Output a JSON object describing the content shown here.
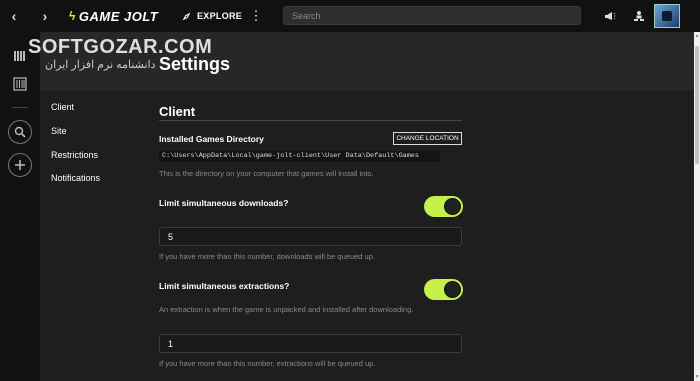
{
  "topbar": {
    "back_icon": "chevron-left-icon",
    "forward_icon": "chevron-right-icon",
    "logo_text": "GAME JOLT",
    "explore_label": "EXPLORE",
    "search_placeholder": "Search",
    "icons": [
      "megaphone-icon",
      "friends-icon",
      "avatar"
    ]
  },
  "watermark": {
    "text": "SOFTGOZAR.COM",
    "subtext": "دانشنامه نرم افزار ایران"
  },
  "page": {
    "title": "Settings"
  },
  "sidenav": {
    "items": [
      "Client",
      "Site",
      "Restrictions",
      "Notifications"
    ]
  },
  "client": {
    "section_title": "Client",
    "install_dir_label": "Installed Games Directory",
    "change_location_label": "CHANGE LOCATION",
    "install_path": "C:\\Users\\AppData\\Local\\game-jolt-client\\User Data\\Default\\Games",
    "install_dir_help": "This is the directory on your computer that games will install into.",
    "limit_downloads_label": "Limit simultaneous downloads?",
    "limit_downloads_enabled": true,
    "downloads_value": "5",
    "downloads_help": "If you have more than this number, downloads will be queued up.",
    "limit_extractions_label": "Limit simultaneous extractions?",
    "limit_extractions_enabled": true,
    "extractions_description": "An extraction is when the game is unpacked and installed after downloading.",
    "extractions_value": "1",
    "extractions_help": "If you have more than this number, extractions will be queued up."
  },
  "colors": {
    "accent": "#c6f04a",
    "background": "#1e1e1e",
    "topbar": "#111111"
  }
}
